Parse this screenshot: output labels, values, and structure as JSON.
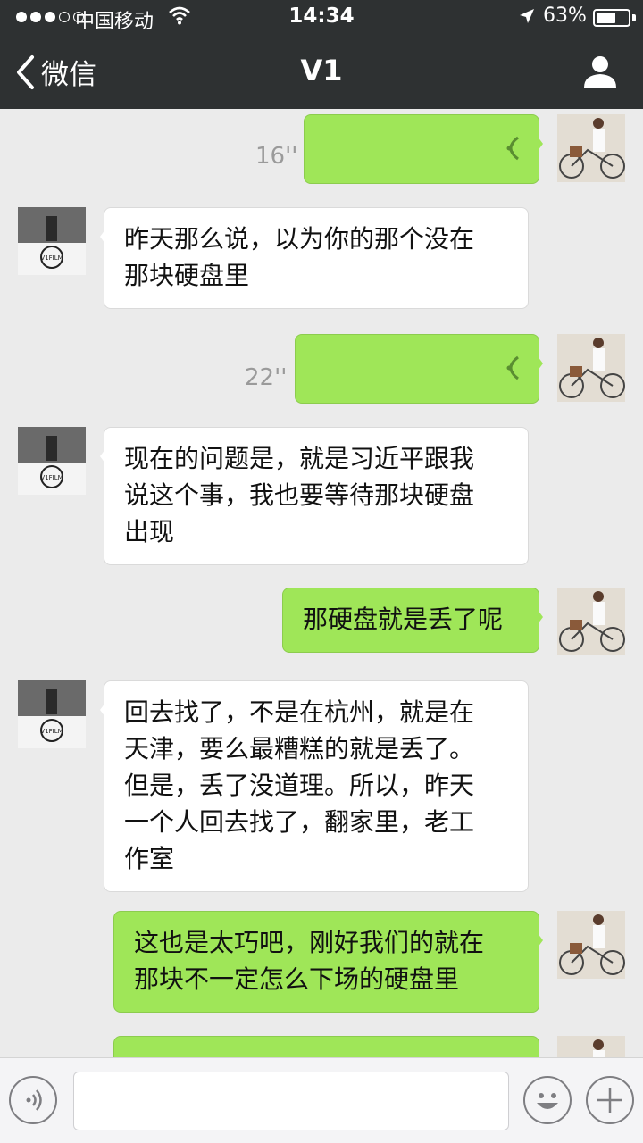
{
  "status_bar": {
    "carrier": "中国移动",
    "time": "14:34",
    "battery_percent": "63%",
    "battery_level": 0.63,
    "signal_bars": 3
  },
  "nav": {
    "back_label": "微信",
    "title": "V1",
    "icons": {
      "back": "chevron-left-icon",
      "profile": "person-icon"
    }
  },
  "messages": [
    {
      "sender": "me",
      "type": "voice",
      "duration": "16''"
    },
    {
      "sender": "other",
      "type": "text",
      "lines": [
        "昨天那么说，以为你的那个没在",
        "那块硬盘里"
      ]
    },
    {
      "sender": "me",
      "type": "voice",
      "duration": "22''"
    },
    {
      "sender": "other",
      "type": "text",
      "lines": [
        "现在的问题是，就是习近平跟我",
        "说这个事，我也要等待那块硬盘",
        "出现"
      ]
    },
    {
      "sender": "me",
      "type": "text",
      "lines": [
        "那硬盘就是丢了呢"
      ]
    },
    {
      "sender": "other",
      "type": "text",
      "lines": [
        "回去找了，不是在杭州，就是在",
        "天津，要么最糟糕的就是丢了。",
        "但是，丢了没道理。所以，昨天",
        "一个人回去找了，翻家里，老工",
        "作室"
      ]
    },
    {
      "sender": "me",
      "type": "text",
      "lines": [
        "这也是太巧吧，刚好我们的就在",
        "那块不一定怎么下场的硬盘里"
      ]
    },
    {
      "sender": "me",
      "type": "text",
      "lines": [
        ""
      ]
    }
  ],
  "avatars": {
    "other_logo_text": "V1FILM"
  },
  "input_bar": {
    "placeholder": "",
    "icons": {
      "voice": "voice-mode-icon",
      "emoji": "emoji-icon",
      "more": "plus-icon"
    }
  },
  "colors": {
    "nav_bg": "#2e3132",
    "chat_bg": "#ebebeb",
    "my_bubble": "#9fe658",
    "other_bubble": "#ffffff",
    "duration_text": "#9a9a9a"
  }
}
